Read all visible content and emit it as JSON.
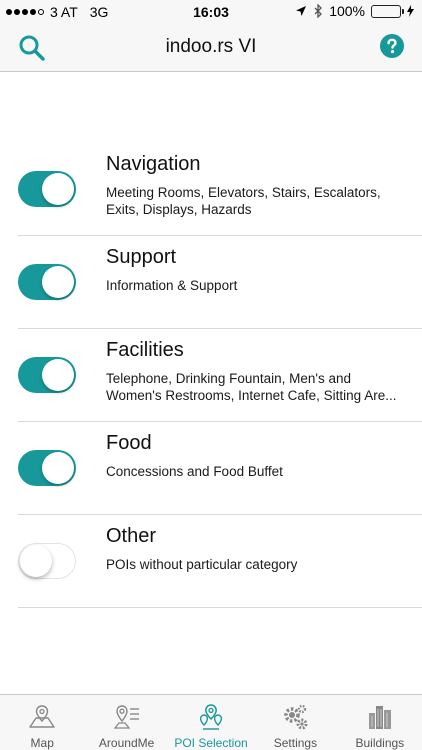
{
  "status_bar": {
    "carrier": "3 AT",
    "network": "3G",
    "time": "16:03",
    "battery": "100%",
    "battery_level": 1.0
  },
  "nav": {
    "title": "indoo.rs VI",
    "search_icon": "search-icon",
    "help_icon": "help-icon",
    "accent_color": "#17989a"
  },
  "poi_categories": [
    {
      "title": "Navigation",
      "desc_line1": "Meeting Rooms, Elevators, Stairs, Escalators,",
      "desc_line2": "Exits, Displays, Hazards",
      "enabled": true
    },
    {
      "title": "Support",
      "desc_line1": "Information & Support",
      "desc_line2": "",
      "enabled": true
    },
    {
      "title": "Facilities",
      "desc_line1": "Telephone, Drinking Fountain, Men's and",
      "desc_line2": "Women's Restrooms, Internet Cafe, Sitting Are...",
      "enabled": true
    },
    {
      "title": "Food",
      "desc_line1": "Concessions and Food Buffet",
      "desc_line2": "",
      "enabled": true
    },
    {
      "title": "Other",
      "desc_line1": "POIs without particular category",
      "desc_line2": "",
      "enabled": false
    }
  ],
  "tabs": [
    {
      "label": "Map",
      "icon": "map-icon",
      "active": false
    },
    {
      "label": "AroundMe",
      "icon": "around-me-icon",
      "active": false
    },
    {
      "label": "POI Selection",
      "icon": "poi-selection-icon",
      "active": true
    },
    {
      "label": "Settings",
      "icon": "gears-icon",
      "active": false
    },
    {
      "label": "Buildings",
      "icon": "buildings-icon",
      "active": false
    }
  ]
}
